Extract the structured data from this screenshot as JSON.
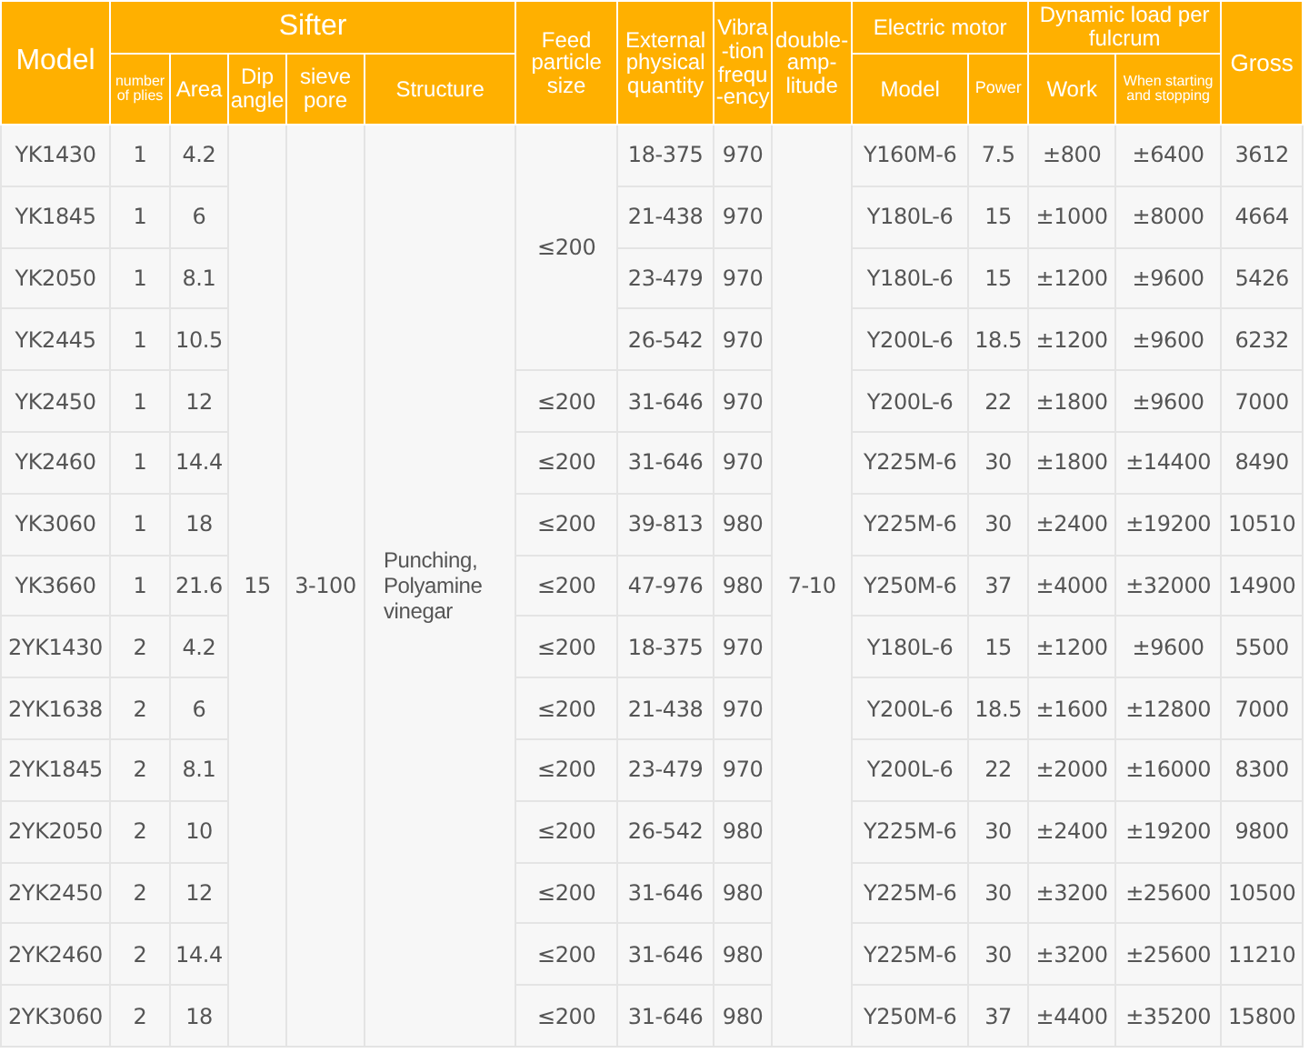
{
  "header": {
    "model": "Model",
    "sifter": "Sifter",
    "sifter_columns": [
      "number of plies",
      "Area",
      "Dip angle",
      "sieve pore",
      "Structure"
    ],
    "feed": "Feed particle size",
    "external": "External physical quantity",
    "vibration": "Vibra-tion frequ-ency",
    "amplitude": "double-amp-litude",
    "motor": "Electric motor",
    "motor_columns": [
      "Model",
      "Power"
    ],
    "load": "Dynamic load per fulcrum",
    "load_columns": [
      "Work",
      "When starting and stopping"
    ],
    "gross": "Gross"
  },
  "shared": {
    "dip_angle": "15",
    "sieve_pore": "3-100",
    "structure": "Punching, Polyamine vinegar",
    "double_amplitude": "7-10",
    "feed_group": "≤200"
  },
  "rows": [
    {
      "model": "YK1430",
      "plies": "1",
      "area": "4.2",
      "external": "18-375",
      "vibration": "970",
      "motor": "Y160M-6",
      "power": "7.5",
      "work": "±800",
      "starting": "±6400",
      "gross": "3612"
    },
    {
      "model": "YK1845",
      "plies": "1",
      "area": "6",
      "external": "21-438",
      "vibration": "970",
      "motor": "Y180L-6",
      "power": "15",
      "work": "±1000",
      "starting": "±8000",
      "gross": "4664"
    },
    {
      "model": "YK2050",
      "plies": "1",
      "area": "8.1",
      "external": "23-479",
      "vibration": "970",
      "motor": "Y180L-6",
      "power": "15",
      "work": "±1200",
      "starting": "±9600",
      "gross": "5426"
    },
    {
      "model": "YK2445",
      "plies": "1",
      "area": "10.5",
      "external": "26-542",
      "vibration": "970",
      "motor": "Y200L-6",
      "power": "18.5",
      "work": "±1200",
      "starting": "±9600",
      "gross": "6232"
    },
    {
      "model": "YK2450",
      "plies": "1",
      "area": "12",
      "feed": "≤200",
      "external": "31-646",
      "vibration": "970",
      "motor": "Y200L-6",
      "power": "22",
      "work": "±1800",
      "starting": "±9600",
      "gross": "7000"
    },
    {
      "model": "YK2460",
      "plies": "1",
      "area": "14.4",
      "feed": "≤200",
      "external": "31-646",
      "vibration": "970",
      "motor": "Y225M-6",
      "power": "30",
      "work": "±1800",
      "starting": "±14400",
      "gross": "8490"
    },
    {
      "model": "YK3060",
      "plies": "1",
      "area": "18",
      "feed": "≤200",
      "external": "39-813",
      "vibration": "980",
      "motor": "Y225M-6",
      "power": "30",
      "work": "±2400",
      "starting": "±19200",
      "gross": "10510"
    },
    {
      "model": "YK3660",
      "plies": "1",
      "area": "21.6",
      "feed": "≤200",
      "external": "47-976",
      "vibration": "980",
      "motor": "Y250M-6",
      "power": "37",
      "work": "±4000",
      "starting": "±32000",
      "gross": "14900"
    },
    {
      "model": "2YK1430",
      "plies": "2",
      "area": "4.2",
      "feed": "≤200",
      "external": "18-375",
      "vibration": "970",
      "motor": "Y180L-6",
      "power": "15",
      "work": "±1200",
      "starting": "±9600",
      "gross": "5500"
    },
    {
      "model": "2YK1638",
      "plies": "2",
      "area": "6",
      "feed": "≤200",
      "external": "21-438",
      "vibration": "970",
      "motor": "Y200L-6",
      "power": "18.5",
      "work": "±1600",
      "starting": "±12800",
      "gross": "7000"
    },
    {
      "model": "2YK1845",
      "plies": "2",
      "area": "8.1",
      "feed": "≤200",
      "external": "23-479",
      "vibration": "970",
      "motor": "Y200L-6",
      "power": "22",
      "work": "±2000",
      "starting": "±16000",
      "gross": "8300"
    },
    {
      "model": "2YK2050",
      "plies": "2",
      "area": "10",
      "feed": "≤200",
      "external": "26-542",
      "vibration": "980",
      "motor": "Y225M-6",
      "power": "30",
      "work": "±2400",
      "starting": "±19200",
      "gross": "9800"
    },
    {
      "model": "2YK2450",
      "plies": "2",
      "area": "12",
      "feed": "≤200",
      "external": "31-646",
      "vibration": "980",
      "motor": "Y225M-6",
      "power": "30",
      "work": "±3200",
      "starting": "±25600",
      "gross": "10500"
    },
    {
      "model": "2YK2460",
      "plies": "2",
      "area": "14.4",
      "feed": "≤200",
      "external": "31-646",
      "vibration": "980",
      "motor": "Y225M-6",
      "power": "30",
      "work": "±3200",
      "starting": "±25600",
      "gross": "11210"
    },
    {
      "model": "2YK3060",
      "plies": "2",
      "area": "18",
      "feed": "≤200",
      "external": "31-646",
      "vibration": "980",
      "motor": "Y250M-6",
      "power": "37",
      "work": "±4400",
      "starting": "±35200",
      "gross": "15800"
    }
  ]
}
